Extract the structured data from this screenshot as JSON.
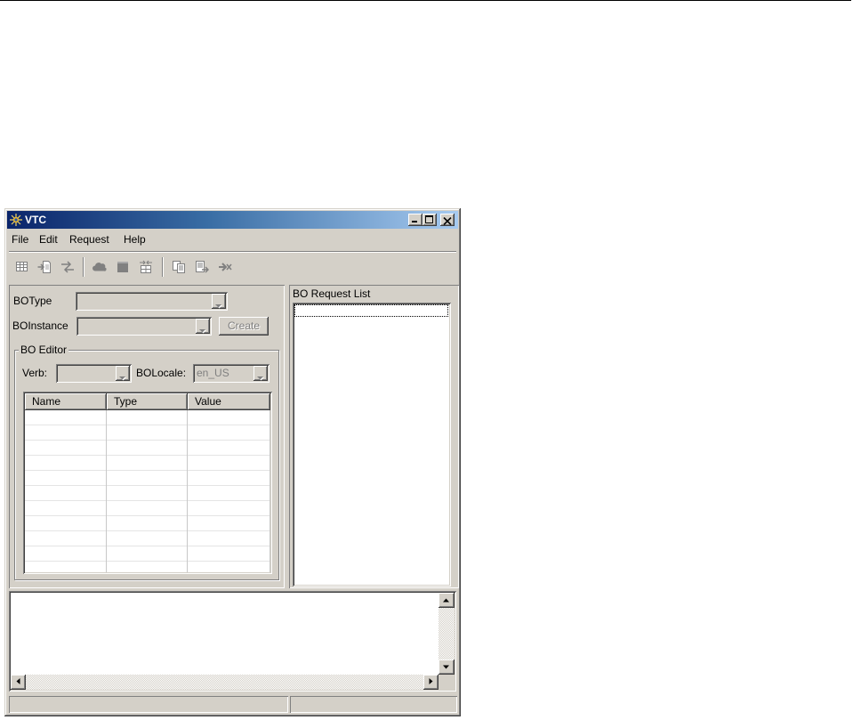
{
  "window": {
    "title": "VTC",
    "app_icon": "vtc-app-icon",
    "controls": [
      "minimize-icon",
      "maximize-icon",
      "close-icon"
    ]
  },
  "menu": {
    "items": [
      "File",
      "Edit",
      "Request",
      "Help"
    ]
  },
  "toolbar": {
    "icons": [
      "grid-icon",
      "import-document-icon",
      "transfer-arrows-icon",
      "cloud-icon",
      "stop-square-icon",
      "swap-icon",
      "documents-icon",
      "export-document-icon",
      "delete-arrow-icon"
    ],
    "enabled": false
  },
  "bo_form": {
    "botype_label": "BOType",
    "botype_value": "",
    "boinstance_label": "BOInstance",
    "boinstance_value": "",
    "create_button": "Create"
  },
  "bo_editor": {
    "title": "BO Editor",
    "verb_label": "Verb:",
    "verb_value": "",
    "locale_label": "BOLocale:",
    "locale_value": "en_US",
    "columns": [
      "Name",
      "Type",
      "Value"
    ],
    "rows": []
  },
  "request_list": {
    "title": "BO Request List",
    "items": []
  },
  "output": {
    "text": ""
  },
  "status_bar": {
    "left": "",
    "right": ""
  },
  "colors": {
    "title_bar_start": "#0a246a",
    "title_bar_end": "#a6caf0",
    "window_face": "#d4d0c8",
    "disabled_text": "#808080"
  }
}
